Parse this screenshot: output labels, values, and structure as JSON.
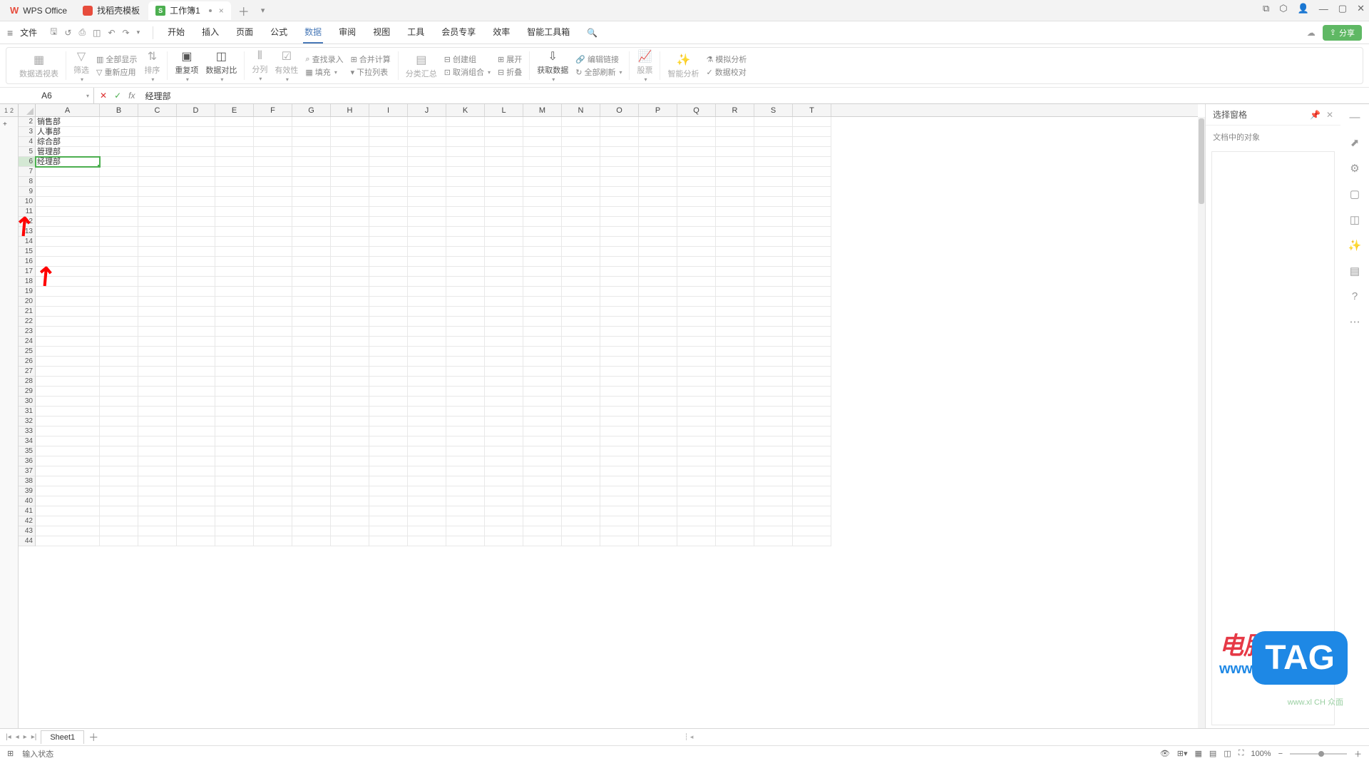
{
  "titlebar": {
    "app_name": "WPS Office",
    "template_tab": "找稻壳模板",
    "doc_tab": "工作簿1",
    "sheet_badge": "S"
  },
  "menubar": {
    "file": "文件",
    "tabs": [
      "开始",
      "插入",
      "页面",
      "公式",
      "数据",
      "审阅",
      "视图",
      "工具",
      "会员专享",
      "效率",
      "智能工具箱"
    ],
    "active_tab_index": 4,
    "share": "分享"
  },
  "ribbon": {
    "pivot": "数据透视表",
    "filter": "筛选",
    "show_all": "全部显示",
    "reapply": "重新应用",
    "sort": "排序",
    "dedup": "重复项",
    "compare": "数据对比",
    "split": "分列",
    "validity": "有效性",
    "find_input": "查找录入",
    "merge_calc": "合并计算",
    "fill": "填充",
    "dropdown_list": "下拉列表",
    "subtotal": "分类汇总",
    "create_group": "创建组",
    "ungroup": "取消组合",
    "expand": "展开",
    "collapse": "折叠",
    "get_data": "获取数据",
    "edit_links": "编辑链接",
    "refresh_all": "全部刷新",
    "stocks": "股票",
    "smart_analysis": "智能分析",
    "sim_analysis": "模拟分析",
    "data_check": "数据校对"
  },
  "namebox": "A6",
  "formula": "经理部",
  "outline_levels": [
    "1",
    "2"
  ],
  "columns": [
    "A",
    "B",
    "C",
    "D",
    "E",
    "F",
    "G",
    "H",
    "I",
    "J",
    "K",
    "L",
    "M",
    "N",
    "O",
    "P",
    "Q",
    "R",
    "S",
    "T"
  ],
  "rows": {
    "visible_row_numbers": [
      2,
      3,
      4,
      5,
      6,
      7,
      8,
      9,
      10,
      11,
      12,
      13,
      14,
      15,
      16,
      17,
      18,
      19,
      20,
      21,
      22,
      23,
      24,
      25,
      26,
      27,
      28,
      29,
      30,
      31,
      32,
      33,
      34,
      35,
      36,
      37,
      38,
      39,
      40,
      41,
      42,
      43,
      44
    ],
    "data": {
      "2": "销售部",
      "3": "人事部",
      "4": "综合部",
      "5": "管理部",
      "6": "经理部"
    },
    "active_row": 6
  },
  "right_panel": {
    "title": "选择窗格",
    "subtitle": "文档中的对象"
  },
  "sheet_tabs": {
    "sheet1": "Sheet1"
  },
  "statusbar": {
    "mode": "输入状态",
    "zoom": "100%"
  },
  "watermark": {
    "cn": "电脑技术网",
    "url": "www.tagxp.com",
    "tag": "TAG",
    "corner": "www.xl CH 众面"
  }
}
